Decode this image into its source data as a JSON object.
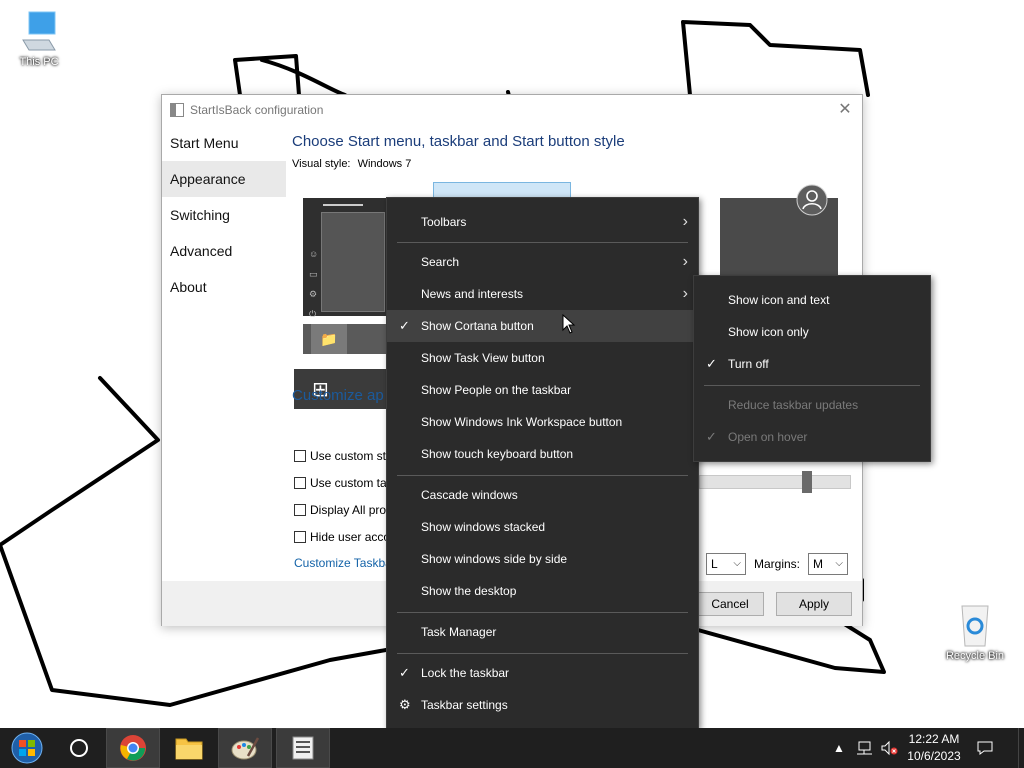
{
  "desktop": {
    "icons": [
      {
        "label": "This PC"
      },
      {
        "label": "Recycle Bin"
      }
    ]
  },
  "config_window": {
    "title": "StartIsBack configuration",
    "nav": [
      "Start Menu",
      "Appearance",
      "Switching",
      "Advanced",
      "About"
    ],
    "active_nav": "Appearance",
    "heading": "Choose Start menu, taskbar and Start button style",
    "visual_style_label": "Visual style:",
    "visual_style_value": "Windows 7",
    "customize_heading": "Customize ap",
    "checkboxes": [
      "Use custom st",
      "Use custom ta",
      "Display All pro",
      "Hide user acco"
    ],
    "link": "Customize Taskba",
    "size_select": "L",
    "margins_label": "Margins:",
    "margins_select": "M",
    "cancel_label": "Cancel",
    "apply_label": "Apply"
  },
  "context_menu": {
    "items": [
      {
        "label": "Toolbars",
        "submenu": true
      },
      {
        "label": "Search",
        "submenu": true
      },
      {
        "label": "News and interests",
        "submenu": true
      },
      {
        "label": "Show Cortana button",
        "checked": true
      },
      {
        "label": "Show Task View button"
      },
      {
        "label": "Show People on the taskbar"
      },
      {
        "label": "Show Windows Ink Workspace button"
      },
      {
        "label": "Show touch keyboard button"
      },
      {
        "label": "Cascade windows"
      },
      {
        "label": "Show windows stacked"
      },
      {
        "label": "Show windows side by side"
      },
      {
        "label": "Show the desktop"
      },
      {
        "label": "Task Manager"
      },
      {
        "label": "Lock the taskbar",
        "checked": true
      },
      {
        "label": "Taskbar settings",
        "icon": "gear-icon"
      }
    ]
  },
  "submenu": {
    "items": [
      {
        "label": "Show icon and text"
      },
      {
        "label": "Show icon only"
      },
      {
        "label": "Turn off",
        "checked": true
      },
      {
        "label": "Reduce taskbar updates",
        "disabled": true
      },
      {
        "label": "Open on hover",
        "disabled": true,
        "checked": true
      }
    ]
  },
  "taskbar": {
    "apps": [
      "start-orb-icon",
      "cortana-circle-icon",
      "chrome-icon",
      "file-explorer-icon",
      "paint-icon",
      "startisback-config-icon"
    ],
    "time": "12:22 AM",
    "date": "10/6/2023"
  },
  "colors": {
    "menu_bg": "#2b2b2b",
    "taskbar_bg": "#1f1f1f",
    "heading": "#1b3d7a"
  }
}
